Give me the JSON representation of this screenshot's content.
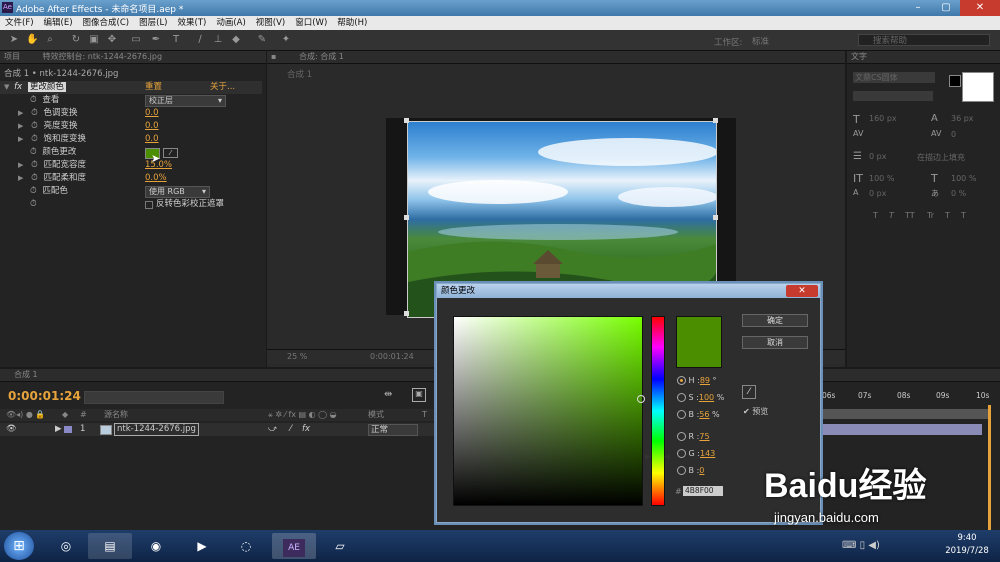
{
  "window": {
    "title": "Adobe After Effects - 未命名项目.aep *",
    "app_icon": "Ae"
  },
  "menu": [
    "文件(F)",
    "编辑(E)",
    "图像合成(C)",
    "图层(L)",
    "效果(T)",
    "动画(A)",
    "视图(V)",
    "窗口(W)",
    "帮助(H)"
  ],
  "toolbar": {
    "workspace_label": "工作区:",
    "workspace_value": "标准",
    "search_placeholder": "搜索帮助"
  },
  "project_tab": "项目",
  "effect_controls": {
    "tab": "特效控制台: ntk-1244-2676.jpg",
    "breadcrumb": "合成 1 • ntk-1244-2676.jpg",
    "fx_label": "fx",
    "effect_name": "更改颜色",
    "reset": "重置",
    "about": "关于...",
    "rows": [
      {
        "label": "查看",
        "value": "校正层",
        "kind": "dropdown"
      },
      {
        "label": "色调变换",
        "value": "0.0",
        "kind": "number"
      },
      {
        "label": "亮度变换",
        "value": "0.0",
        "kind": "number"
      },
      {
        "label": "饱和度变换",
        "value": "0.0",
        "kind": "number"
      },
      {
        "label": "颜色更改",
        "value": "",
        "kind": "color"
      },
      {
        "label": "匹配宽容度",
        "value": "15.0%",
        "kind": "number"
      },
      {
        "label": "匹配柔和度",
        "value": "0.0%",
        "kind": "number"
      },
      {
        "label": "匹配色",
        "value": "使用 RGB",
        "kind": "dropdown"
      },
      {
        "label": "",
        "value": "反转色彩校正遮罩",
        "kind": "checkbox"
      }
    ]
  },
  "composition": {
    "tab": "合成: 合成 1",
    "sub_tab": "合成 1",
    "zoom": "25 %",
    "timecode": "0:00:01:24"
  },
  "character_panel": {
    "tab": "文字",
    "font": "文鼎CS圆体",
    "size": "160 px",
    "leading": "36 px",
    "tracking": "0",
    "indent": "0 px",
    "stroke_option": "在描边上填充",
    "vscale": "100 %",
    "hscale": "100 %",
    "baseline": "0 px",
    "tsume": "0 %",
    "style_buttons": [
      "T",
      "T",
      "TT",
      "Tr",
      "T",
      "T"
    ]
  },
  "timeline": {
    "tab": "合成 1",
    "timecode": "0:00:01:24",
    "columns": {
      "source": "源名称",
      "mode": "模式",
      "t": "T"
    },
    "layer": {
      "index": "1",
      "name": "ntk-1244-2676.jpg",
      "mode": "正常"
    },
    "ruler": [
      "06s",
      "07s",
      "08s",
      "09s",
      "10s"
    ]
  },
  "color_dialog": {
    "title": "颜色更改",
    "ok": "确定",
    "cancel": "取消",
    "preview": "预览",
    "h_label": "H",
    "h_value": "89",
    "h_unit": "°",
    "s_label": "S",
    "s_value": "100",
    "s_unit": "%",
    "b_label": "B",
    "b_value": "56",
    "b_unit": "%",
    "r_label": "R",
    "r_value": "75",
    "g_label": "G",
    "g_value": "143",
    "b2_label": "B",
    "b2_value": "0",
    "hash": "#",
    "hex": "4B8F00",
    "selected_color": "#4B8F00"
  },
  "taskbar": {
    "time": "9:40",
    "date": "2019/7/28",
    "ae_label": "AE"
  },
  "watermark": {
    "brand": "Baidu经验",
    "url": "jingyan.baidu.com"
  }
}
